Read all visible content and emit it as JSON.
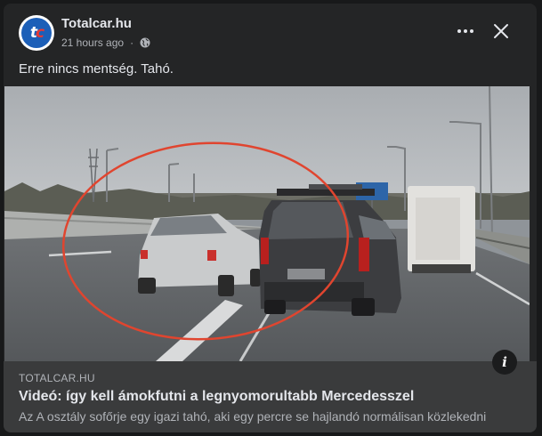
{
  "post": {
    "page_name": "Totalcar.hu",
    "timestamp": "21 hours ago",
    "separator": "·",
    "text": "Erre nincs mentség. Tahó."
  },
  "avatar": {
    "letters_t": "t",
    "letters_c": "c"
  },
  "link": {
    "domain": "TOTALCAR.HU",
    "title": "Videó: így kell ámokfutni a legnyomorultabb Mercedesszel",
    "description": "Az A osztály sofőrje egy igazi tahó, aki egy percre se hajlandó normálisan közlekedni"
  },
  "info_button": {
    "glyph": "i"
  },
  "icons": [
    "globe-icon",
    "more-icon",
    "close-icon",
    "info-icon"
  ],
  "colors": {
    "background": "#242526",
    "link_panel": "#3a3b3c",
    "circle": "#e0452f",
    "brand": "#1c5fb8"
  }
}
